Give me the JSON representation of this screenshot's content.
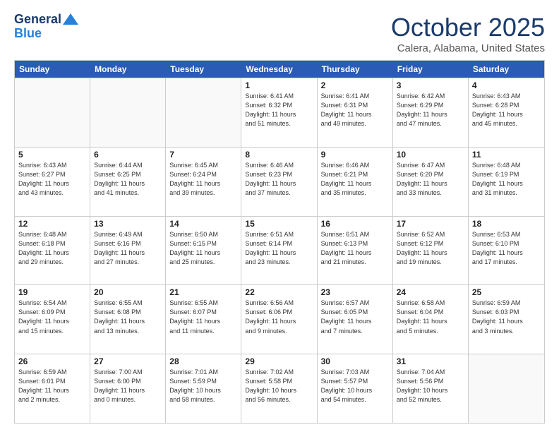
{
  "logo": {
    "line1": "General",
    "line2": "Blue"
  },
  "title": "October 2025",
  "location": "Calera, Alabama, United States",
  "days_of_week": [
    "Sunday",
    "Monday",
    "Tuesday",
    "Wednesday",
    "Thursday",
    "Friday",
    "Saturday"
  ],
  "weeks": [
    [
      {
        "day": "",
        "info": "",
        "empty": true
      },
      {
        "day": "",
        "info": "",
        "empty": true
      },
      {
        "day": "",
        "info": "",
        "empty": true
      },
      {
        "day": "1",
        "info": "Sunrise: 6:41 AM\nSunset: 6:32 PM\nDaylight: 11 hours\nand 51 minutes."
      },
      {
        "day": "2",
        "info": "Sunrise: 6:41 AM\nSunset: 6:31 PM\nDaylight: 11 hours\nand 49 minutes."
      },
      {
        "day": "3",
        "info": "Sunrise: 6:42 AM\nSunset: 6:29 PM\nDaylight: 11 hours\nand 47 minutes."
      },
      {
        "day": "4",
        "info": "Sunrise: 6:43 AM\nSunset: 6:28 PM\nDaylight: 11 hours\nand 45 minutes."
      }
    ],
    [
      {
        "day": "5",
        "info": "Sunrise: 6:43 AM\nSunset: 6:27 PM\nDaylight: 11 hours\nand 43 minutes."
      },
      {
        "day": "6",
        "info": "Sunrise: 6:44 AM\nSunset: 6:25 PM\nDaylight: 11 hours\nand 41 minutes."
      },
      {
        "day": "7",
        "info": "Sunrise: 6:45 AM\nSunset: 6:24 PM\nDaylight: 11 hours\nand 39 minutes."
      },
      {
        "day": "8",
        "info": "Sunrise: 6:46 AM\nSunset: 6:23 PM\nDaylight: 11 hours\nand 37 minutes."
      },
      {
        "day": "9",
        "info": "Sunrise: 6:46 AM\nSunset: 6:21 PM\nDaylight: 11 hours\nand 35 minutes."
      },
      {
        "day": "10",
        "info": "Sunrise: 6:47 AM\nSunset: 6:20 PM\nDaylight: 11 hours\nand 33 minutes."
      },
      {
        "day": "11",
        "info": "Sunrise: 6:48 AM\nSunset: 6:19 PM\nDaylight: 11 hours\nand 31 minutes."
      }
    ],
    [
      {
        "day": "12",
        "info": "Sunrise: 6:48 AM\nSunset: 6:18 PM\nDaylight: 11 hours\nand 29 minutes."
      },
      {
        "day": "13",
        "info": "Sunrise: 6:49 AM\nSunset: 6:16 PM\nDaylight: 11 hours\nand 27 minutes."
      },
      {
        "day": "14",
        "info": "Sunrise: 6:50 AM\nSunset: 6:15 PM\nDaylight: 11 hours\nand 25 minutes."
      },
      {
        "day": "15",
        "info": "Sunrise: 6:51 AM\nSunset: 6:14 PM\nDaylight: 11 hours\nand 23 minutes."
      },
      {
        "day": "16",
        "info": "Sunrise: 6:51 AM\nSunset: 6:13 PM\nDaylight: 11 hours\nand 21 minutes."
      },
      {
        "day": "17",
        "info": "Sunrise: 6:52 AM\nSunset: 6:12 PM\nDaylight: 11 hours\nand 19 minutes."
      },
      {
        "day": "18",
        "info": "Sunrise: 6:53 AM\nSunset: 6:10 PM\nDaylight: 11 hours\nand 17 minutes."
      }
    ],
    [
      {
        "day": "19",
        "info": "Sunrise: 6:54 AM\nSunset: 6:09 PM\nDaylight: 11 hours\nand 15 minutes."
      },
      {
        "day": "20",
        "info": "Sunrise: 6:55 AM\nSunset: 6:08 PM\nDaylight: 11 hours\nand 13 minutes."
      },
      {
        "day": "21",
        "info": "Sunrise: 6:55 AM\nSunset: 6:07 PM\nDaylight: 11 hours\nand 11 minutes."
      },
      {
        "day": "22",
        "info": "Sunrise: 6:56 AM\nSunset: 6:06 PM\nDaylight: 11 hours\nand 9 minutes."
      },
      {
        "day": "23",
        "info": "Sunrise: 6:57 AM\nSunset: 6:05 PM\nDaylight: 11 hours\nand 7 minutes."
      },
      {
        "day": "24",
        "info": "Sunrise: 6:58 AM\nSunset: 6:04 PM\nDaylight: 11 hours\nand 5 minutes."
      },
      {
        "day": "25",
        "info": "Sunrise: 6:59 AM\nSunset: 6:03 PM\nDaylight: 11 hours\nand 3 minutes."
      }
    ],
    [
      {
        "day": "26",
        "info": "Sunrise: 6:59 AM\nSunset: 6:01 PM\nDaylight: 11 hours\nand 2 minutes."
      },
      {
        "day": "27",
        "info": "Sunrise: 7:00 AM\nSunset: 6:00 PM\nDaylight: 11 hours\nand 0 minutes."
      },
      {
        "day": "28",
        "info": "Sunrise: 7:01 AM\nSunset: 5:59 PM\nDaylight: 10 hours\nand 58 minutes."
      },
      {
        "day": "29",
        "info": "Sunrise: 7:02 AM\nSunset: 5:58 PM\nDaylight: 10 hours\nand 56 minutes."
      },
      {
        "day": "30",
        "info": "Sunrise: 7:03 AM\nSunset: 5:57 PM\nDaylight: 10 hours\nand 54 minutes."
      },
      {
        "day": "31",
        "info": "Sunrise: 7:04 AM\nSunset: 5:56 PM\nDaylight: 10 hours\nand 52 minutes."
      },
      {
        "day": "",
        "info": "",
        "empty": true
      }
    ]
  ]
}
